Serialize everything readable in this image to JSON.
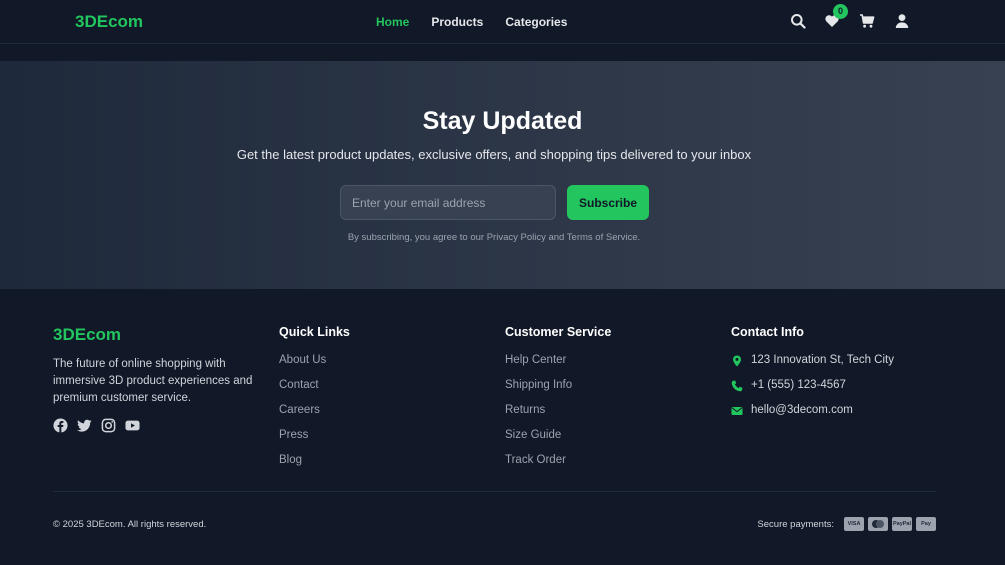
{
  "header": {
    "logo": "3DEcom",
    "nav": [
      {
        "label": "Home"
      },
      {
        "label": "Products"
      },
      {
        "label": "Categories"
      }
    ],
    "wishlist_count": "0",
    "icons": [
      "search-icon",
      "heart-icon",
      "cart-icon",
      "user-icon"
    ]
  },
  "newsletter": {
    "title": "Stay Updated",
    "subtitle": "Get the latest product updates, exclusive offers, and shopping tips delivered to your inbox",
    "email_placeholder": "Enter your email address",
    "subscribe_label": "Subscribe",
    "terms": "By subscribing, you agree to our Privacy Policy and Terms of Service."
  },
  "footer": {
    "brand": "3DEcom",
    "description": "The future of online shopping with immersive 3D product experiences and premium customer service.",
    "social_icons": [
      "facebook-icon",
      "twitter-icon",
      "instagram-icon",
      "youtube-icon"
    ],
    "quick_links": {
      "title": "Quick Links",
      "items": [
        "About Us",
        "Contact",
        "Careers",
        "Press",
        "Blog"
      ]
    },
    "customer_service": {
      "title": "Customer Service",
      "items": [
        "Help Center",
        "Shipping Info",
        "Returns",
        "Size Guide",
        "Track Order"
      ]
    },
    "contact": {
      "title": "Contact Info",
      "address": "123 Innovation St, Tech City",
      "phone": "+1 (555) 123-4567",
      "email": "hello@3decom.com"
    },
    "copyright": "© 2025 3DEcom. All rights reserved.",
    "secure_payments_label": "Secure payments:",
    "payment_cards": [
      "VISA",
      "MC",
      "PayPal",
      "Pay"
    ]
  },
  "colors": {
    "accent": "#22c55e",
    "background": "#111827",
    "newsletter_bg": "#2d3748"
  }
}
